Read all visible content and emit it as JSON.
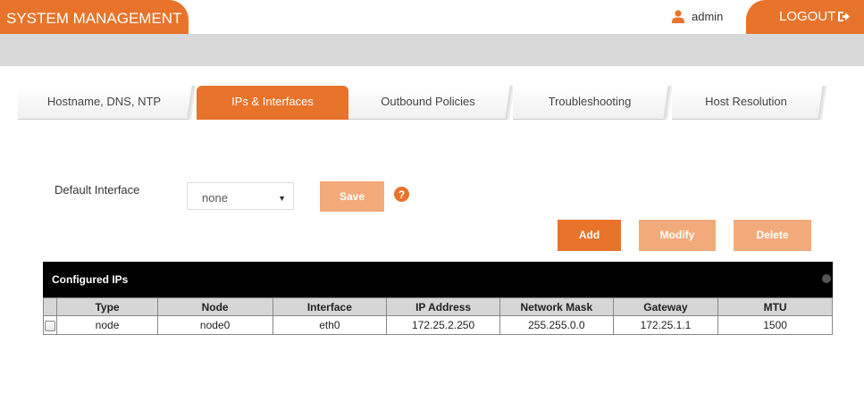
{
  "header": {
    "title": "SYSTEM MANAGEMENT",
    "user": "admin",
    "user_icon": "user-icon",
    "logout_label": "LOGOUT",
    "logout_icon": "sign-out-icon",
    "accent_color": "#e8732a"
  },
  "tabs": [
    {
      "label": "Hostname, DNS, NTP",
      "active": false
    },
    {
      "label": "IPs & Interfaces",
      "active": true
    },
    {
      "label": "Outbound Policies",
      "active": false
    },
    {
      "label": "Troubleshooting",
      "active": false
    },
    {
      "label": "Host Resolution",
      "active": false
    }
  ],
  "form": {
    "default_interface_label": "Default Interface",
    "default_interface_value": "none",
    "save_label": "Save",
    "help_icon": "question-circle-icon"
  },
  "actions": {
    "add_label": "Add",
    "modify_label": "Modify",
    "delete_label": "Delete"
  },
  "table": {
    "title": "Configured IPs",
    "columns": [
      "Type",
      "Node",
      "Interface",
      "IP Address",
      "Network Mask",
      "Gateway",
      "MTU"
    ],
    "rows": [
      {
        "checked": false,
        "cells": [
          "node",
          "node0",
          "eth0",
          "172.25.2.250",
          "255.255.0.0",
          "172.25.1.1",
          "1500"
        ]
      }
    ]
  }
}
